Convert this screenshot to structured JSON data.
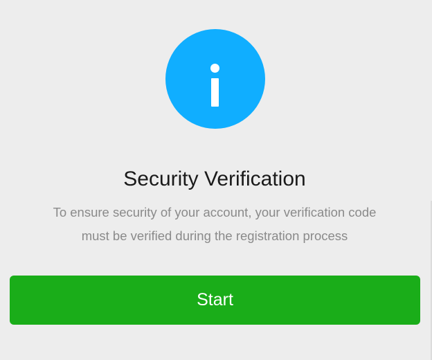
{
  "colors": {
    "background": "#ededed",
    "accent_info": "#10aeff",
    "primary_button": "#1aad19",
    "title_text": "#1a1a1a",
    "description_text": "#8a8a8a"
  },
  "icon": {
    "name": "info-icon"
  },
  "main": {
    "title": "Security Verification",
    "description_line1": "To ensure security of your account, your verification code",
    "description_line2": "must be verified during the registration process"
  },
  "actions": {
    "start_label": "Start"
  }
}
